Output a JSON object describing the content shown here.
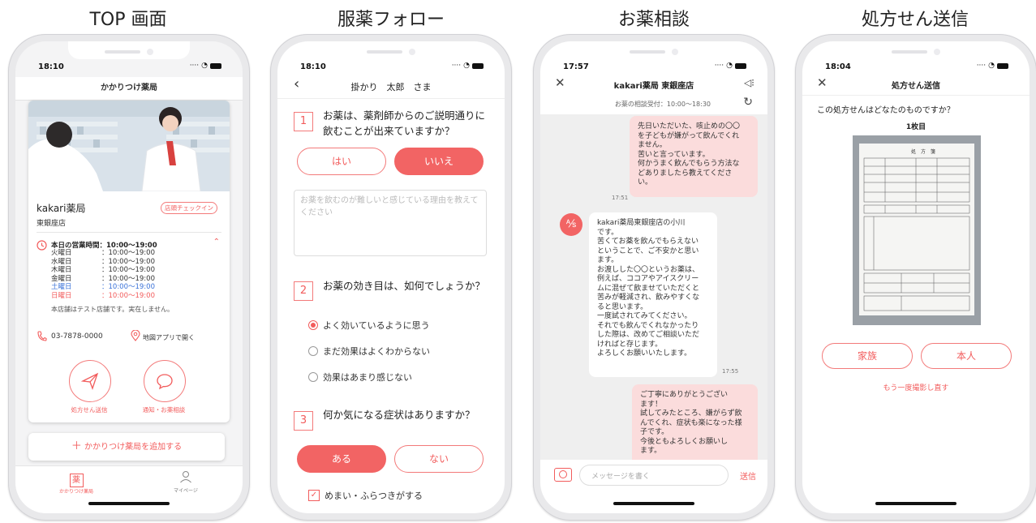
{
  "titles": [
    "TOP 画面",
    "服薬フォロー",
    "お薬相談",
    "処方せん送信"
  ],
  "colors": {
    "accent": "#f25c5c",
    "chat_bg": "#efefef",
    "bubble_me": "#fbdcdc"
  },
  "screen1": {
    "time": "18:10",
    "header": "かかりつけ薬局",
    "pharmacy_name": "kakari薬局",
    "branch": "東銀座店",
    "checkin_label": "店頭チェックイン",
    "hours_title": "本日の営業時間：10:00〜19:00",
    "hours": [
      {
        "day": "火曜日",
        "time": "：10:00〜19:00",
        "color": "normal"
      },
      {
        "day": "水曜日",
        "time": "：10:00〜19:00",
        "color": "normal"
      },
      {
        "day": "木曜日",
        "time": "：10:00〜19:00",
        "color": "normal"
      },
      {
        "day": "金曜日",
        "time": "：10:00〜19:00",
        "color": "normal"
      },
      {
        "day": "土曜日",
        "time": "：10:00〜19:00",
        "color": "blue"
      },
      {
        "day": "日曜日",
        "time": "：10:00〜19:00",
        "color": "red"
      }
    ],
    "note": "本店舗はテスト店舗です。実在しません。",
    "phone": "03-7878-0000",
    "map_link": "地図アプリで開く",
    "btn_prescription": "処方せん送信",
    "btn_consult": "通知・お薬相談",
    "add_pharmacy": "かかりつけ薬局を追加する",
    "tab_home": "かかりつけ薬局",
    "tab_home_icon": "薬",
    "tab_mypage": "マイページ"
  },
  "screen2": {
    "time": "18:10",
    "header": "掛かり　太郎　さま",
    "q1_num": "1",
    "q1_text": "お薬は、薬剤師からのご説明通りに飲むことが出来ていますか？",
    "q1_yes": "はい",
    "q1_no": "いいえ",
    "textarea_placeholder": "お薬を飲むのが難しいと感じている理由を教えてください",
    "q2_num": "2",
    "q2_text": "お薬の効き目は、如何でしょうか？",
    "q2_options": [
      "よく効いているように思う",
      "まだ効果はよくわからない",
      "効果はあまり感じない"
    ],
    "q3_num": "3",
    "q3_text": "何か気になる症状はありますか？",
    "q3_yes": "ある",
    "q3_no": "ない",
    "check_label": "めまい・ふらつきがする"
  },
  "screen3": {
    "time": "17:57",
    "header": "kakari薬局 東銀座店",
    "sub": "お薬の相談受付：10:00〜18:30",
    "msg1": "先日いただいた、咳止めの〇〇\nを子どもが嫌がって飲んでくれ\nません。\n苦いと言っています。\n何かうまく飲んでもらう方法な\nどありましたら教えてくださ\nい。",
    "msg1_time": "17:51",
    "msg2": "kakari薬局東銀座店の小川\nです。\n苦くてお薬を飲んでもらえない\nということで、ご不安かと思い\nます。\nお渡しした〇〇というお薬は、\n例えば、ココアやアイスクリー\nムに混ぜて飲ませていただくと\n苦みが軽減され、飲みやすくな\nると思います。\n一度試されてみてください。\nそれでも飲んでくれなかったり\nした際は、改めてご相談いただ\nければと存じます。\nよろしくお願いいたします。",
    "msg2_time": "17:55",
    "msg3": "ご丁寧にありがとうござい\nます！\n試してみたところ、嫌がらず飲\nんでくれ、症状も楽になった様\n子です。\n今後ともよろしくお願いし\nます。",
    "input_placeholder": "メッセージを書く",
    "send_label": "送信"
  },
  "screen4": {
    "time": "18:04",
    "header": "処方せん送信",
    "question": "この処方せんはどなたのものですか？",
    "page_label": "1枚目",
    "doc_title": "処　方　箋",
    "btn_family": "家族",
    "btn_self": "本人",
    "retake": "もう一度撮影し直す"
  }
}
